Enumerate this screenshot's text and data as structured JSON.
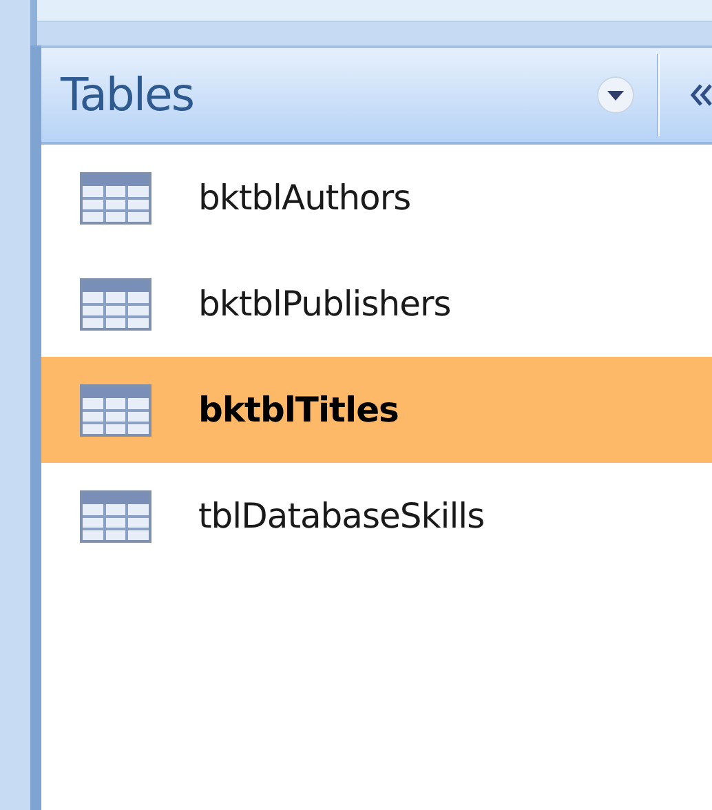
{
  "pane": {
    "title": "Tables"
  },
  "items": [
    {
      "label": "bktblAuthors",
      "selected": false
    },
    {
      "label": "bktblPublishers",
      "selected": false
    },
    {
      "label": "bktblTitles",
      "selected": true
    },
    {
      "label": "tblDatabaseSkills",
      "selected": false
    }
  ]
}
